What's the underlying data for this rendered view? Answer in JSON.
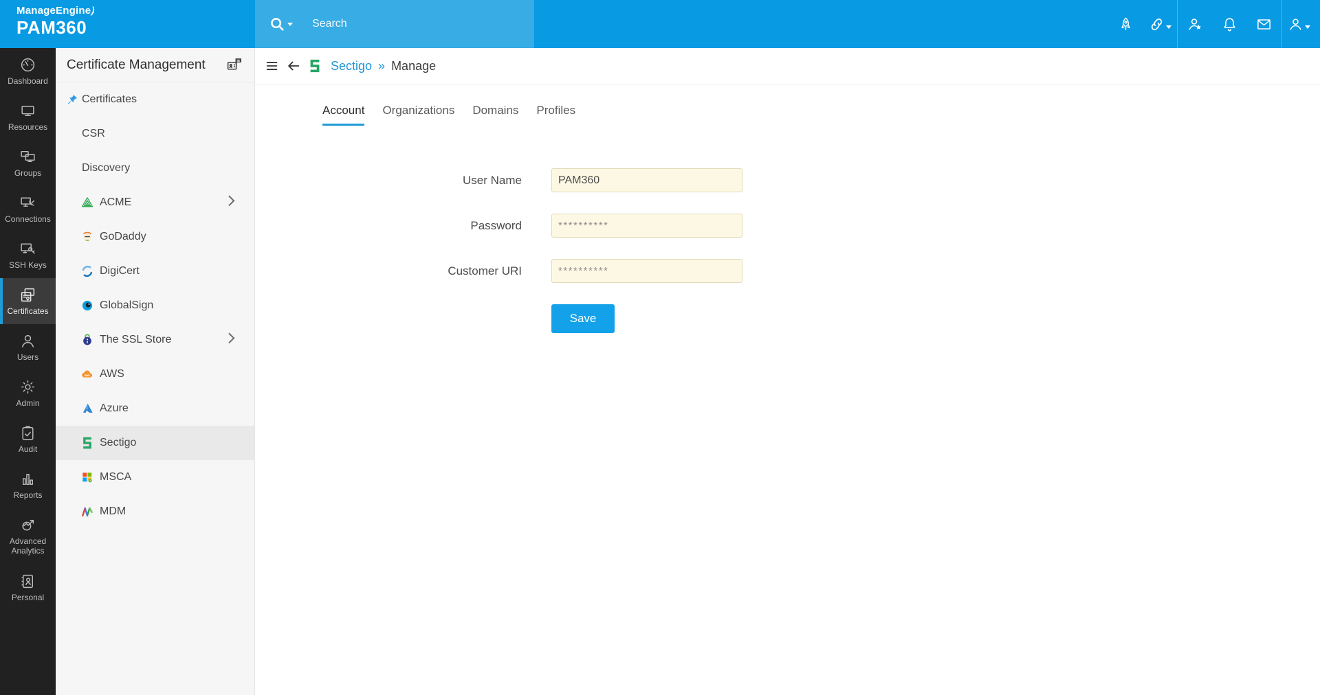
{
  "brand": {
    "name_top": "ManageEngine",
    "name_bottom": "PAM360"
  },
  "topbar": {
    "search_placeholder": "Search",
    "search_icon": "search-icon",
    "right_icons": [
      {
        "icon": "rocket-icon",
        "sep_before": false,
        "caret": false
      },
      {
        "icon": "link-icon",
        "sep_before": false,
        "caret": true
      },
      {
        "icon": "user-star-icon",
        "sep_before": true,
        "caret": false
      },
      {
        "icon": "bell-icon",
        "sep_before": false,
        "caret": false
      },
      {
        "icon": "mail-icon",
        "sep_before": false,
        "caret": false
      },
      {
        "icon": "user-icon",
        "sep_before": true,
        "caret": true
      }
    ]
  },
  "primary_nav": [
    {
      "label": "Dashboard",
      "icon": "dashboard-icon",
      "active": false
    },
    {
      "label": "Resources",
      "icon": "resources-icon",
      "active": false
    },
    {
      "label": "Groups",
      "icon": "groups-icon",
      "active": false
    },
    {
      "label": "Connections",
      "icon": "connections-icon",
      "active": false
    },
    {
      "label": "SSH Keys",
      "icon": "ssh-keys-icon",
      "active": false
    },
    {
      "label": "Certificates",
      "icon": "certificates-icon",
      "active": true
    },
    {
      "label": "Users",
      "icon": "users-icon",
      "active": false
    },
    {
      "label": "Admin",
      "icon": "admin-icon",
      "active": false
    },
    {
      "label": "Audit",
      "icon": "audit-icon",
      "active": false
    },
    {
      "label": "Reports",
      "icon": "reports-icon",
      "active": false
    },
    {
      "label": "Advanced Analytics",
      "icon": "advanced-analytics-icon",
      "active": false,
      "tall": true
    },
    {
      "label": "Personal",
      "icon": "personal-icon",
      "active": false
    }
  ],
  "secondary_nav": {
    "title": "Certificate Management",
    "title_icon": "certificate-request-icon",
    "items": [
      {
        "label": "Certificates",
        "pin": "pin-icon",
        "active": false,
        "chevron": false
      },
      {
        "label": "CSR",
        "active": false,
        "chevron": false
      },
      {
        "label": "Discovery",
        "active": false,
        "chevron": false
      },
      {
        "label": "ACME",
        "icon": "acme-icon",
        "active": false,
        "chevron": true
      },
      {
        "label": "GoDaddy",
        "icon": "godaddy-icon",
        "active": false,
        "chevron": false
      },
      {
        "label": "DigiCert",
        "icon": "digicert-icon",
        "active": false,
        "chevron": false
      },
      {
        "label": "GlobalSign",
        "icon": "globalsign-icon",
        "active": false,
        "chevron": false
      },
      {
        "label": "The SSL Store",
        "icon": "sslstore-icon",
        "active": false,
        "chevron": true
      },
      {
        "label": "AWS",
        "icon": "aws-icon",
        "active": false,
        "chevron": false
      },
      {
        "label": "Azure",
        "icon": "azure-icon",
        "active": false,
        "chevron": false
      },
      {
        "label": "Sectigo",
        "icon": "sectigo-icon",
        "active": true,
        "chevron": false
      },
      {
        "label": "MSCA",
        "icon": "msca-icon",
        "active": false,
        "chevron": false
      },
      {
        "label": "MDM",
        "icon": "mdm-icon",
        "active": false,
        "chevron": false
      }
    ]
  },
  "breadcrumb": {
    "logo": "sectigo-icon",
    "link": "Sectigo",
    "separator": "»",
    "current": "Manage"
  },
  "tabs": [
    {
      "label": "Account",
      "active": true
    },
    {
      "label": "Organizations",
      "active": false
    },
    {
      "label": "Domains",
      "active": false
    },
    {
      "label": "Profiles",
      "active": false
    }
  ],
  "form": {
    "fields": [
      {
        "label": "User Name",
        "value": "PAM360",
        "masked": false
      },
      {
        "label": "Password",
        "value": "**********",
        "masked": true
      },
      {
        "label": "Customer URI",
        "value": "**********",
        "masked": true
      }
    ],
    "save_label": "Save"
  },
  "colors": {
    "topbar_blue": "#089ae3",
    "search_blue": "#38ace4",
    "accent_blue": "#1e9cd9",
    "sidebar_dark": "#212121",
    "link_blue": "#2196d6",
    "input_bg": "#fdf8e3",
    "save_button_bg": "#13a2e9",
    "sectigo_green": "#26a566"
  }
}
